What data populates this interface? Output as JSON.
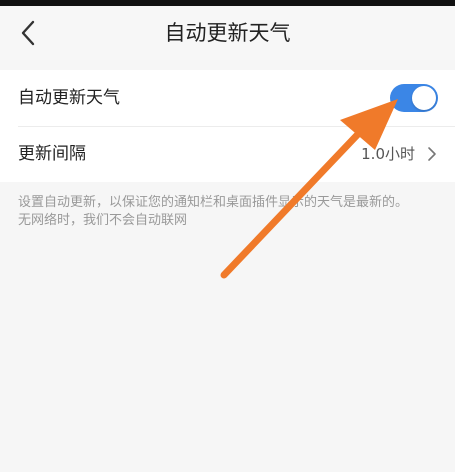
{
  "header": {
    "title": "自动更新天气",
    "back_icon": "chevron-left-icon"
  },
  "settings": {
    "auto_update": {
      "label": "自动更新天气",
      "enabled": true,
      "toggle_color": "#3b86e6"
    },
    "interval": {
      "label": "更新间隔",
      "value": "1.0小时",
      "chevron_icon": "chevron-right-icon"
    }
  },
  "description": {
    "line1": "设置自动更新，以保证您的通知栏和桌面插件显示的天气是最新的。",
    "line2": "无网络时，我们不会自动联网"
  },
  "annotation": {
    "arrow_color": "#f07a2a"
  }
}
